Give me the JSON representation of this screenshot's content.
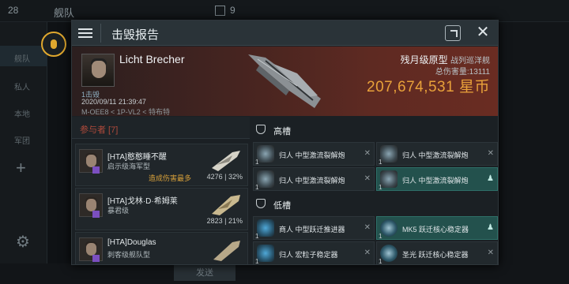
{
  "background": {
    "count": "28",
    "tab": "舰队",
    "box_count": "9",
    "send": "发送",
    "menu": [
      "舰队",
      "私人",
      "本地",
      "军团"
    ]
  },
  "dialog": {
    "title": "击毁报告",
    "victim": {
      "name": "Licht Brecher",
      "kills": "1击毁",
      "date": "2020/09/11 21:39:47",
      "location": "M-OEE8 < 1P-VL2 < 特布特"
    },
    "ship": {
      "name": "残月级原型",
      "class": "战列巡洋舰",
      "damage_label": "总伤害量:",
      "damage": "13111",
      "value": "207,674,531",
      "unit": "星币"
    },
    "participants": {
      "header": "参与者 [7]",
      "items": [
        {
          "name": "[HTA]憨憨睡不醒",
          "ship": "启示级海军型",
          "tag": "造成伤害最多",
          "damage": "4276",
          "pct": "32%"
        },
        {
          "name": "[HTA]戈林·D·希姆莱",
          "ship": "暴君级",
          "tag": "",
          "damage": "2823",
          "pct": "21%"
        },
        {
          "name": "[HTA]Douglas",
          "ship": "刺客级舰队型",
          "tag": "",
          "damage": "",
          "pct": ""
        }
      ]
    },
    "slots": {
      "high": {
        "label": "高槽",
        "items": [
          {
            "qty": "1",
            "name": "归人 中型激流裂解炮"
          },
          {
            "qty": "1",
            "name": "归人 中型激流裂解炮"
          },
          {
            "qty": "1",
            "name": "归人 中型激流裂解炮"
          },
          {
            "qty": "1",
            "name": "归人 中型激流裂解炮"
          }
        ]
      },
      "low": {
        "label": "低槽",
        "items": [
          {
            "qty": "1",
            "name": "商人 中型跃迁推进器"
          },
          {
            "qty": "1",
            "name": "MK5 跃迁核心稳定器"
          },
          {
            "qty": "1",
            "name": "归人 宏粒子稳定器"
          },
          {
            "qty": "1",
            "name": "圣光 跃迁核心稳定器"
          }
        ]
      }
    }
  }
}
